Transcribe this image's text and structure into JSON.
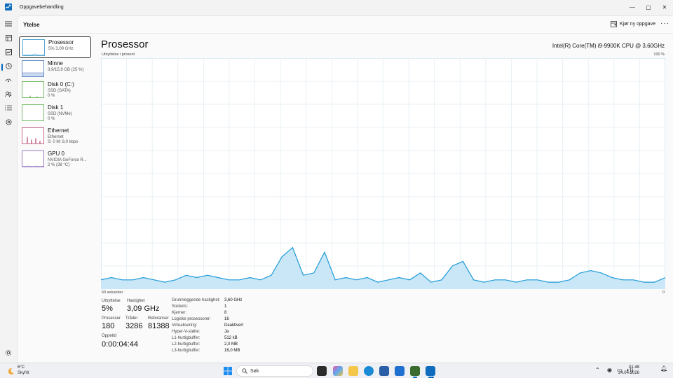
{
  "window": {
    "title": "Oppgavebehandling"
  },
  "header": {
    "title": "Ytelse",
    "run_task_label": "Kjør ny oppgave"
  },
  "devices": [
    {
      "name": "Prosessor",
      "sub1": "5% 3,09 GHz",
      "sub2": ""
    },
    {
      "name": "Minne",
      "sub1": "3,9/15,9 GB (25 %)",
      "sub2": ""
    },
    {
      "name": "Disk 0 (C:)",
      "sub1": "SSD (SATA)",
      "sub2": "0 %"
    },
    {
      "name": "Disk 1",
      "sub1": "SSD (NVMe)",
      "sub2": "0 %"
    },
    {
      "name": "Ethernet",
      "sub1": "Ethernet",
      "sub2": "S: 0 M: 8,0 kbps"
    },
    {
      "name": "GPU 0",
      "sub1": "NVIDIA GeForce R...",
      "sub2": "2 % (38 °C)"
    }
  ],
  "detail": {
    "title": "Prosessor",
    "model": "Intel(R) Core(TM) i9-9900K CPU @ 3,60GHz",
    "graph_label": "Utnyttelse i prosent",
    "graph_max": "100 %",
    "graph_x_left": "60 sekunder",
    "graph_x_right": "0",
    "utilization_series": [
      4,
      5,
      4,
      4,
      5,
      4,
      3,
      4,
      6,
      5,
      6,
      5,
      4,
      4,
      5,
      4,
      6,
      14,
      18,
      6,
      7,
      16,
      4,
      5,
      4,
      5,
      3,
      4,
      5,
      4,
      7,
      3,
      4,
      10,
      12,
      4,
      3,
      4,
      4,
      3,
      4,
      4,
      3,
      3,
      4,
      7,
      8,
      7,
      5,
      4,
      4,
      3,
      3,
      5
    ]
  },
  "stats": {
    "utilization": {
      "label": "Utnyttelse",
      "value": "5%"
    },
    "speed": {
      "label": "Hastighet",
      "value": "3,09 GHz"
    },
    "processes": {
      "label": "Prosesser",
      "value": "180"
    },
    "threads": {
      "label": "Tråder",
      "value": "3286"
    },
    "handles": {
      "label": "Referanser",
      "value": "81388"
    },
    "uptime": {
      "label": "Oppetid",
      "value": "0:00:04:44"
    }
  },
  "specs": [
    {
      "label": "Grunnleggende hastighet:",
      "value": "3,60 GHz"
    },
    {
      "label": "Sockets:",
      "value": "1"
    },
    {
      "label": "Kjerner:",
      "value": "8"
    },
    {
      "label": "Logiske prosessorer:",
      "value": "16"
    },
    {
      "label": "Virtualisering:",
      "value": "Deaktivert"
    },
    {
      "label": "Hyper-V-støtte:",
      "value": "Ja"
    },
    {
      "label": "L1-hurtigbuffer:",
      "value": "512 kB"
    },
    {
      "label": "L2-hurtigbuffer:",
      "value": "2,0 MB"
    },
    {
      "label": "L3-hurtigbuffer:",
      "value": "16,0 MB"
    }
  ],
  "taskbar": {
    "temp": "6°C",
    "weather": "Skyfrit",
    "search": "Søk",
    "time": "01:48",
    "date": "24.04.2026"
  },
  "colors": {
    "accent": "#0067c0",
    "cpu_line": "#1e9ad8",
    "cpu_fill": "#c9e7f6",
    "grid": "#e3eef3"
  }
}
